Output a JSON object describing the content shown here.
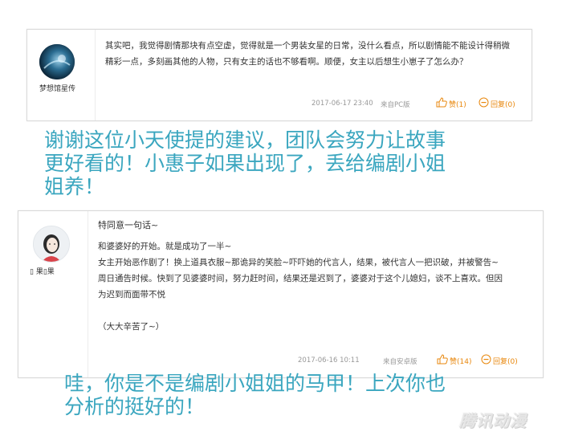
{
  "comment1": {
    "username": "梦想馆星传",
    "lines": [
      "其实吧，我觉得剧情那块有点空虚，觉得就是一个男装女星的日常，没什么看点，所以剧情能不能设计得稍微",
      "精彩一点，多刻画其他的人物，只有女主的话也不够看啊。顺便，女主以后想生小崽子了怎么办？"
    ],
    "date": "2017-06-17 23:40",
    "source": "来自PC版",
    "like_label": "赞(1)",
    "reply_label": "回复(0)"
  },
  "reply1": {
    "lines": [
      "谢谢这位小天使提的建议，团队会努力让故事",
      "更好看的！小惠子如果出现了，丢给编剧小姐",
      "姐养！"
    ]
  },
  "comment2": {
    "username": "▯ 果▯果",
    "title": "特同意一句话~",
    "lines": [
      "和婆婆好的开始。就是成功了一半~",
      "女主开始恶作剧了！换上道具衣服~那诡异的笑脸~吓吓她的代言人，结果，被代言人一把识破，并被警告~",
      "周日通告时候。快到了见婆婆时间，努力赶时间，结果还是迟到了，婆婆对于这个儿媳妇，谈不上喜欢。但因",
      "为迟到而面带不悦",
      "",
      "（大大辛苦了~）"
    ],
    "date": "2017-06-16 10:11",
    "source": "来自安卓版",
    "like_label": "赞(14)",
    "reply_label": "回复(0)"
  },
  "reply2": {
    "lines": [
      "哇，你是不是编剧小姐姐的马甲！上次你也",
      "分析的挺好的！"
    ]
  },
  "watermark": "腾讯动漫",
  "colors": {
    "accent": "#e8870c",
    "banner": "#3aa6bf",
    "meta": "#999999"
  },
  "icons": {
    "like": "thumbs-up-icon",
    "reply": "reply-bubble-icon"
  }
}
